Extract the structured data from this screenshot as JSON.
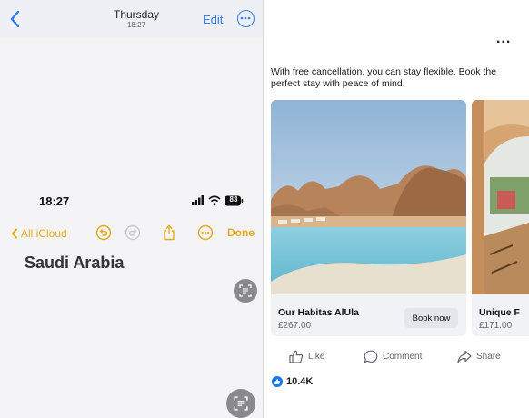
{
  "notes": {
    "header": {
      "title": "Thursday",
      "time": "18:27",
      "edit_label": "Edit"
    },
    "status_bar": {
      "time": "18:27",
      "battery": "83"
    },
    "toolbar": {
      "back_label": "All iCloud",
      "done_label": "Done"
    },
    "note_title": "Saudi Arabia",
    "colors": {
      "accent_blue": "#2d7cf6",
      "accent_yellow": "#e8a81a"
    }
  },
  "post": {
    "menu_label": "...",
    "text": "With free cancellation, you can stay flexible. Book the perfect stay with peace of mind.",
    "cards": [
      {
        "title": "Our Habitas AlUla",
        "price": "£267.00",
        "cta": "Book now"
      },
      {
        "title": "Unique F",
        "price": "£171.00"
      }
    ],
    "actions": {
      "like": "Like",
      "comment": "Comment",
      "share": "Share"
    },
    "reaction_count": "10.4K",
    "colors": {
      "brand_blue": "#1877f2"
    }
  }
}
